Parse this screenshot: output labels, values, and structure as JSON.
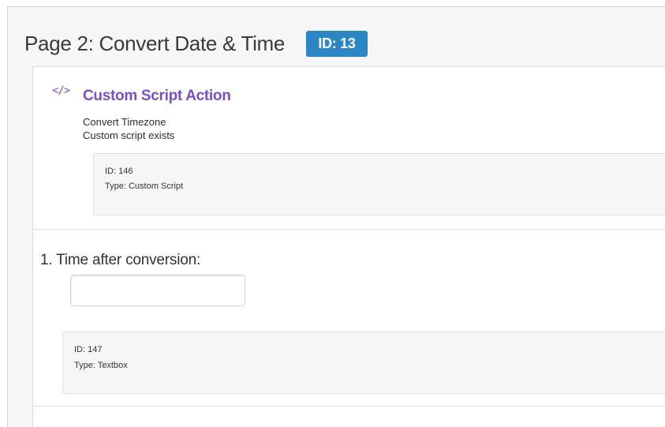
{
  "page": {
    "title": "Page 2: Convert Date & Time",
    "id_badge": "ID: 13"
  },
  "action": {
    "icon": "code-icon",
    "title": "Custom Script Action",
    "line1": "Convert Timezone",
    "line2": "Custom script exists",
    "meta": {
      "id": "ID: 146",
      "type": "Type: Custom Script"
    }
  },
  "question": {
    "label": "1. Time after conversion:",
    "input_value": "",
    "meta": {
      "id": "ID: 147",
      "type": "Type: Textbox"
    }
  },
  "colors": {
    "accent_purple": "#7b4fc9",
    "badge_blue": "#2b86c5",
    "page_bg": "#f6f6f6"
  }
}
